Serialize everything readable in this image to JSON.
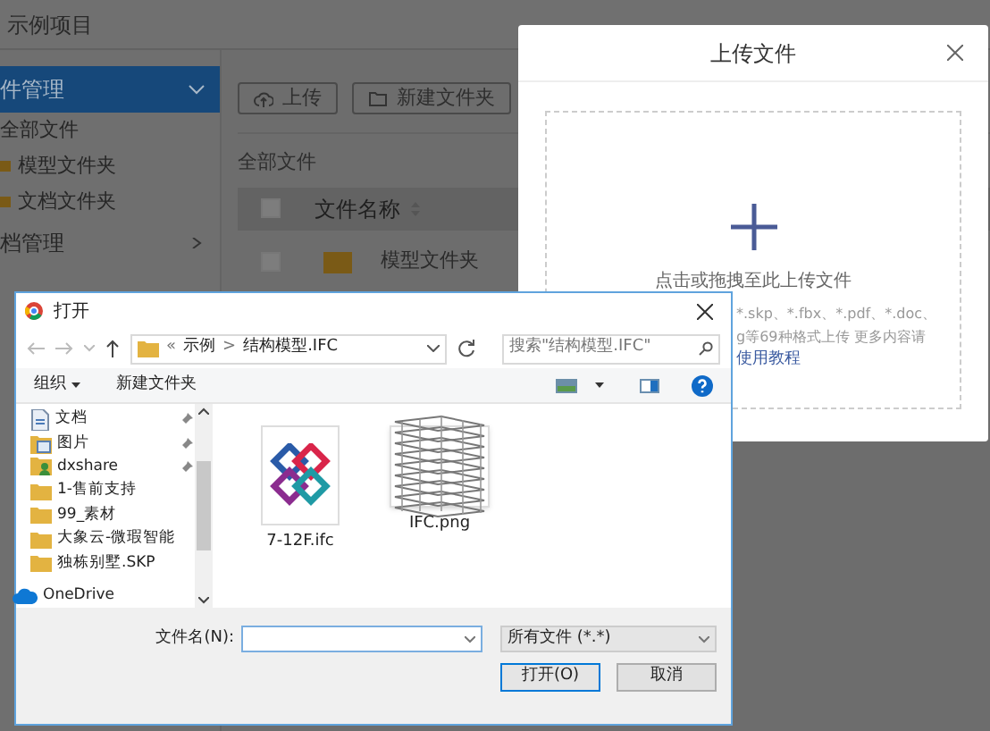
{
  "app": {
    "title": "示例项目",
    "sidebar": {
      "items": [
        {
          "label": "件管理",
          "kind": "section",
          "selected": true,
          "expanded": true
        },
        {
          "label": "全部文件",
          "kind": "item",
          "selected": false
        },
        {
          "label": "模型文件夹",
          "kind": "folder",
          "selected": false
        },
        {
          "label": "文档文件夹",
          "kind": "folder",
          "selected": false
        },
        {
          "label": "档管理",
          "kind": "section",
          "selected": false,
          "expanded": false
        }
      ]
    },
    "toolbar": [
      {
        "label": "上传",
        "kind": "upload"
      },
      {
        "label": "新建文件夹",
        "kind": "folder"
      }
    ],
    "breadcrumb": "全部文件",
    "table": {
      "columns": [
        {
          "label": "文件名称",
          "sortable": true
        }
      ],
      "header_checked": false,
      "rows": [
        {
          "name": "模型文件夹",
          "checked": false
        }
      ]
    }
  },
  "upload_modal": {
    "title": "上传文件",
    "prompt": "点击或拖拽至此上传文件",
    "hint_lines": [
      "*.skp、*.fbx、*.pdf、*.doc、",
      "g等69种格式上传 更多内容请"
    ],
    "link": "使用教程"
  },
  "open_dialog": {
    "title": "打开",
    "path": [
      "«",
      "示例",
      ">",
      "结构模型.IFC"
    ],
    "search": {
      "placeholder": "搜索\"结构模型.IFC\""
    },
    "commands": [
      {
        "label": "组织",
        "dropdown": true
      },
      {
        "label": "新建文件夹",
        "dropdown": false
      }
    ],
    "nav": [
      {
        "label": "文档",
        "kind": "document",
        "pinned": true
      },
      {
        "label": "图片",
        "kind": "picture",
        "pinned": true
      },
      {
        "label": "dxshare",
        "kind": "user",
        "pinned": true
      },
      {
        "label": "1-售前支持",
        "kind": "folder",
        "pinned": false
      },
      {
        "label": "99_素材",
        "kind": "folder",
        "pinned": false
      },
      {
        "label": "大象云-微瑕智能",
        "kind": "folder",
        "pinned": false
      },
      {
        "label": "独栋别墅.SKP",
        "kind": "folder",
        "pinned": false
      },
      {
        "label": "OneDrive",
        "kind": "cloud",
        "pinned": false
      }
    ],
    "files": [
      {
        "name": "7-12F.ifc",
        "kind": "ifc"
      },
      {
        "name": "IFC.png",
        "kind": "image"
      }
    ],
    "filename_label": "文件名(N):",
    "filter": "所有文件 (*.*)",
    "buttons": [
      {
        "label": "打开(O)",
        "kind": "primary"
      },
      {
        "label": "取消",
        "kind": "secondary"
      }
    ]
  }
}
